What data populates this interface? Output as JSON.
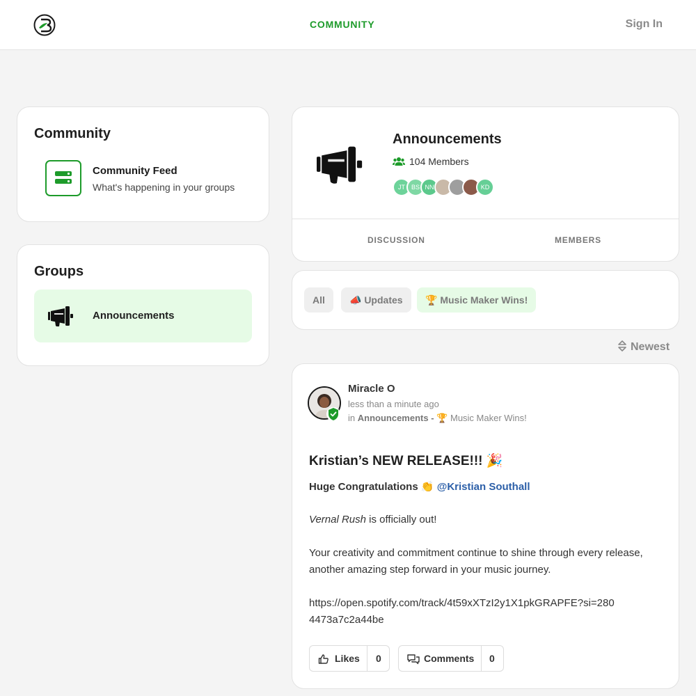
{
  "header": {
    "nav_label": "COMMUNITY",
    "signin_label": "Sign In"
  },
  "sidebar": {
    "community": {
      "title": "Community",
      "feed_title": "Community Feed",
      "feed_subtitle": "What's happening in your groups"
    },
    "groups": {
      "title": "Groups",
      "items": [
        {
          "label": "Announcements"
        }
      ]
    }
  },
  "group": {
    "title": "Announcements",
    "members_count": "104 Members",
    "member_avatars": [
      {
        "initials": "JT",
        "color": "#6dd39a"
      },
      {
        "initials": "BS",
        "color": "#7fd8a4"
      },
      {
        "initials": "NN",
        "color": "#5cc98c"
      },
      {
        "initials": "",
        "color": "#c9b9a8"
      },
      {
        "initials": "",
        "color": "#9e9e9e"
      },
      {
        "initials": "",
        "color": "#8b5a4a"
      },
      {
        "initials": "KD",
        "color": "#66cf96"
      }
    ],
    "tabs": [
      "DISCUSSION",
      "MEMBERS"
    ]
  },
  "filters": {
    "chips": [
      {
        "label": "All"
      },
      {
        "label": "📣 Updates"
      },
      {
        "label": "🏆 Music Maker Wins!"
      }
    ]
  },
  "sort": {
    "label": "Newest"
  },
  "post": {
    "author": "Miracle O",
    "time": "less than a minute ago",
    "in_prefix": "in",
    "group": "Announcements",
    "separator": "-",
    "topic": "🏆 Music Maker Wins!",
    "title": "Kristian’s NEW RELEASE!!! 🎉",
    "congrats": "Huge Congratulations 👏",
    "mention": "@Kristian Southall",
    "release_name": "Vernal Rush",
    "release_suffix": " is officially out!",
    "paragraph": "Your creativity and commitment continue to shine through every release, another amazing step forward in your music journey.",
    "link": "https://open.spotify.com/track/4t59xXTzI2y1X1pkGRAPFE?si=2804473a7c2a44be",
    "likes_label": "Likes",
    "likes_count": "0",
    "comments_label": "Comments",
    "comments_count": "0"
  },
  "colors": {
    "brand_green": "#1d9b2a",
    "active_bg": "#e6fbe6",
    "mention_blue": "#2c5fa8"
  }
}
